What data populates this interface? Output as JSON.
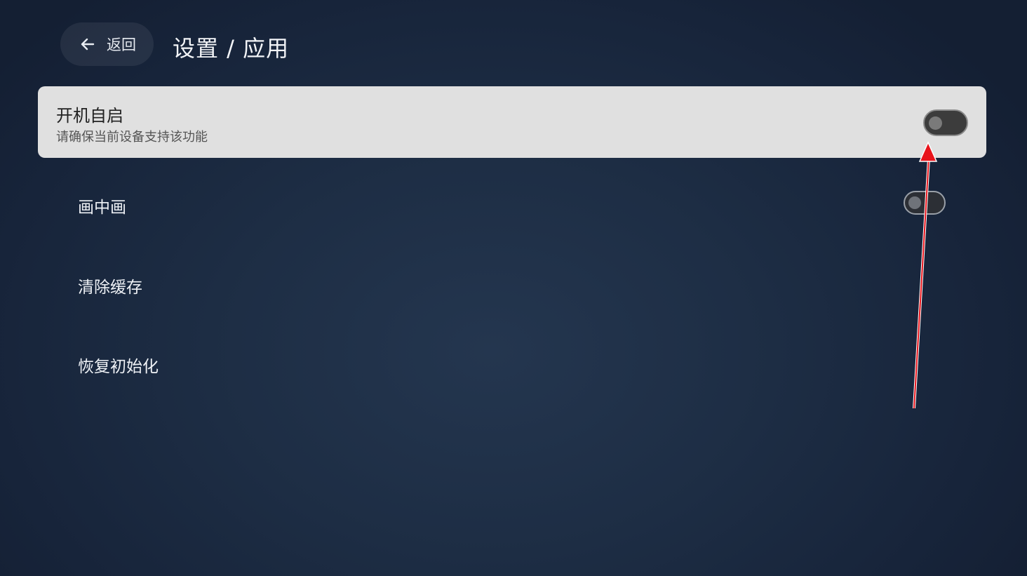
{
  "header": {
    "back_label": "返回",
    "back_icon": "arrow-left-icon",
    "title": "设置 / 应用"
  },
  "settings": {
    "auto_start": {
      "title": "开机自启",
      "subtitle": "请确保当前设备支持该功能",
      "enabled": false
    },
    "pip": {
      "label": "画中画",
      "enabled": false
    },
    "clear_cache": {
      "label": "清除缓存"
    },
    "reset": {
      "label": "恢复初始化"
    }
  },
  "annotation": {
    "arrow_color": "#e8141b"
  },
  "colors": {
    "background": "#1d2d44",
    "card": "#e0e0e0"
  }
}
